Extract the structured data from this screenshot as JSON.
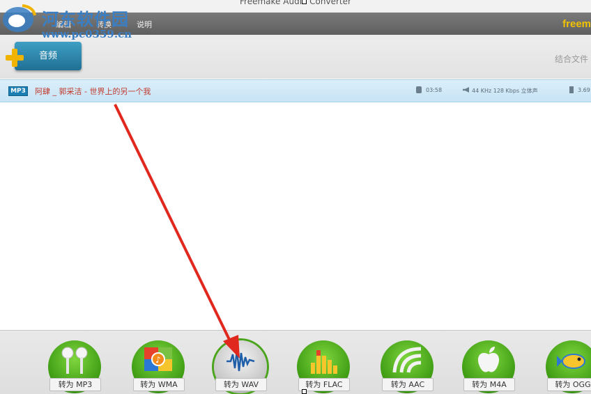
{
  "window": {
    "title": "Freemake Audio Converter"
  },
  "menu": {
    "items": [
      "编辑",
      "转换",
      "说明"
    ]
  },
  "brand": "freem",
  "toolbar": {
    "add_audio_label": "音频",
    "join_files_label": "结合文件"
  },
  "watermark": {
    "title": "河东软件园",
    "url": "www.pc0359.cn"
  },
  "file": {
    "format": "MP3",
    "name": "阿肆 _ 郭采洁 - 世界上的另一个我",
    "duration": "03:58",
    "audio_info": "44 KHz  128 Kbps  立体声",
    "size": "3.69"
  },
  "converters": [
    {
      "label": "转为 MP3",
      "icon": "earphones-icon"
    },
    {
      "label": "转为 WMA",
      "icon": "windows-media-icon"
    },
    {
      "label": "转为 WAV",
      "icon": "waveform-icon"
    },
    {
      "label": "转为 FLAC",
      "icon": "equalizer-icon"
    },
    {
      "label": "转为 AAC",
      "icon": "aac-wave-icon"
    },
    {
      "label": "转为 M4A",
      "icon": "apple-icon"
    },
    {
      "label": "转为 OGG",
      "icon": "fish-icon"
    }
  ],
  "colors": {
    "accent": "#1f6f94",
    "converter_green": "#3c9a12",
    "annotation_arrow": "#e0281e"
  }
}
